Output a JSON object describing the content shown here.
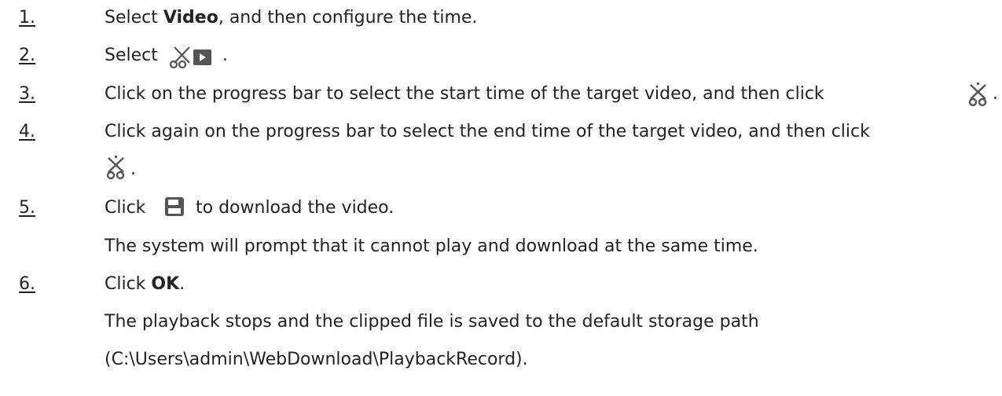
{
  "steps": [
    {
      "number": "1.",
      "before": "Select ",
      "bold": "Video",
      "after": ", and then configure the time."
    },
    {
      "number": "2.",
      "before": "Select",
      "icon": "clip-video-icon",
      "after": "."
    },
    {
      "number": "3.",
      "text": "Click on the progress bar to select the start time of the target video, and then click",
      "icon": "scissors-icon",
      "after": "."
    },
    {
      "number": "4.",
      "text": "Click again on the progress bar to select the end time of the target video, and then click",
      "icon": "scissors-icon",
      "after": "."
    },
    {
      "number": "5.",
      "before": "Click",
      "icon": "save-icon",
      "after": "to download the video.",
      "result": "The system will prompt that it cannot play and download at the same time."
    },
    {
      "number": "6.",
      "before": "Click ",
      "bold": "OK",
      "after": ".",
      "result_line1": "The playback stops and the clipped file is saved to the default storage path",
      "result_line2": "(C:\\Users\\admin\\WebDownload\\PlaybackRecord)."
    }
  ],
  "colors": {
    "text": "#222222",
    "icon": "#555555"
  }
}
